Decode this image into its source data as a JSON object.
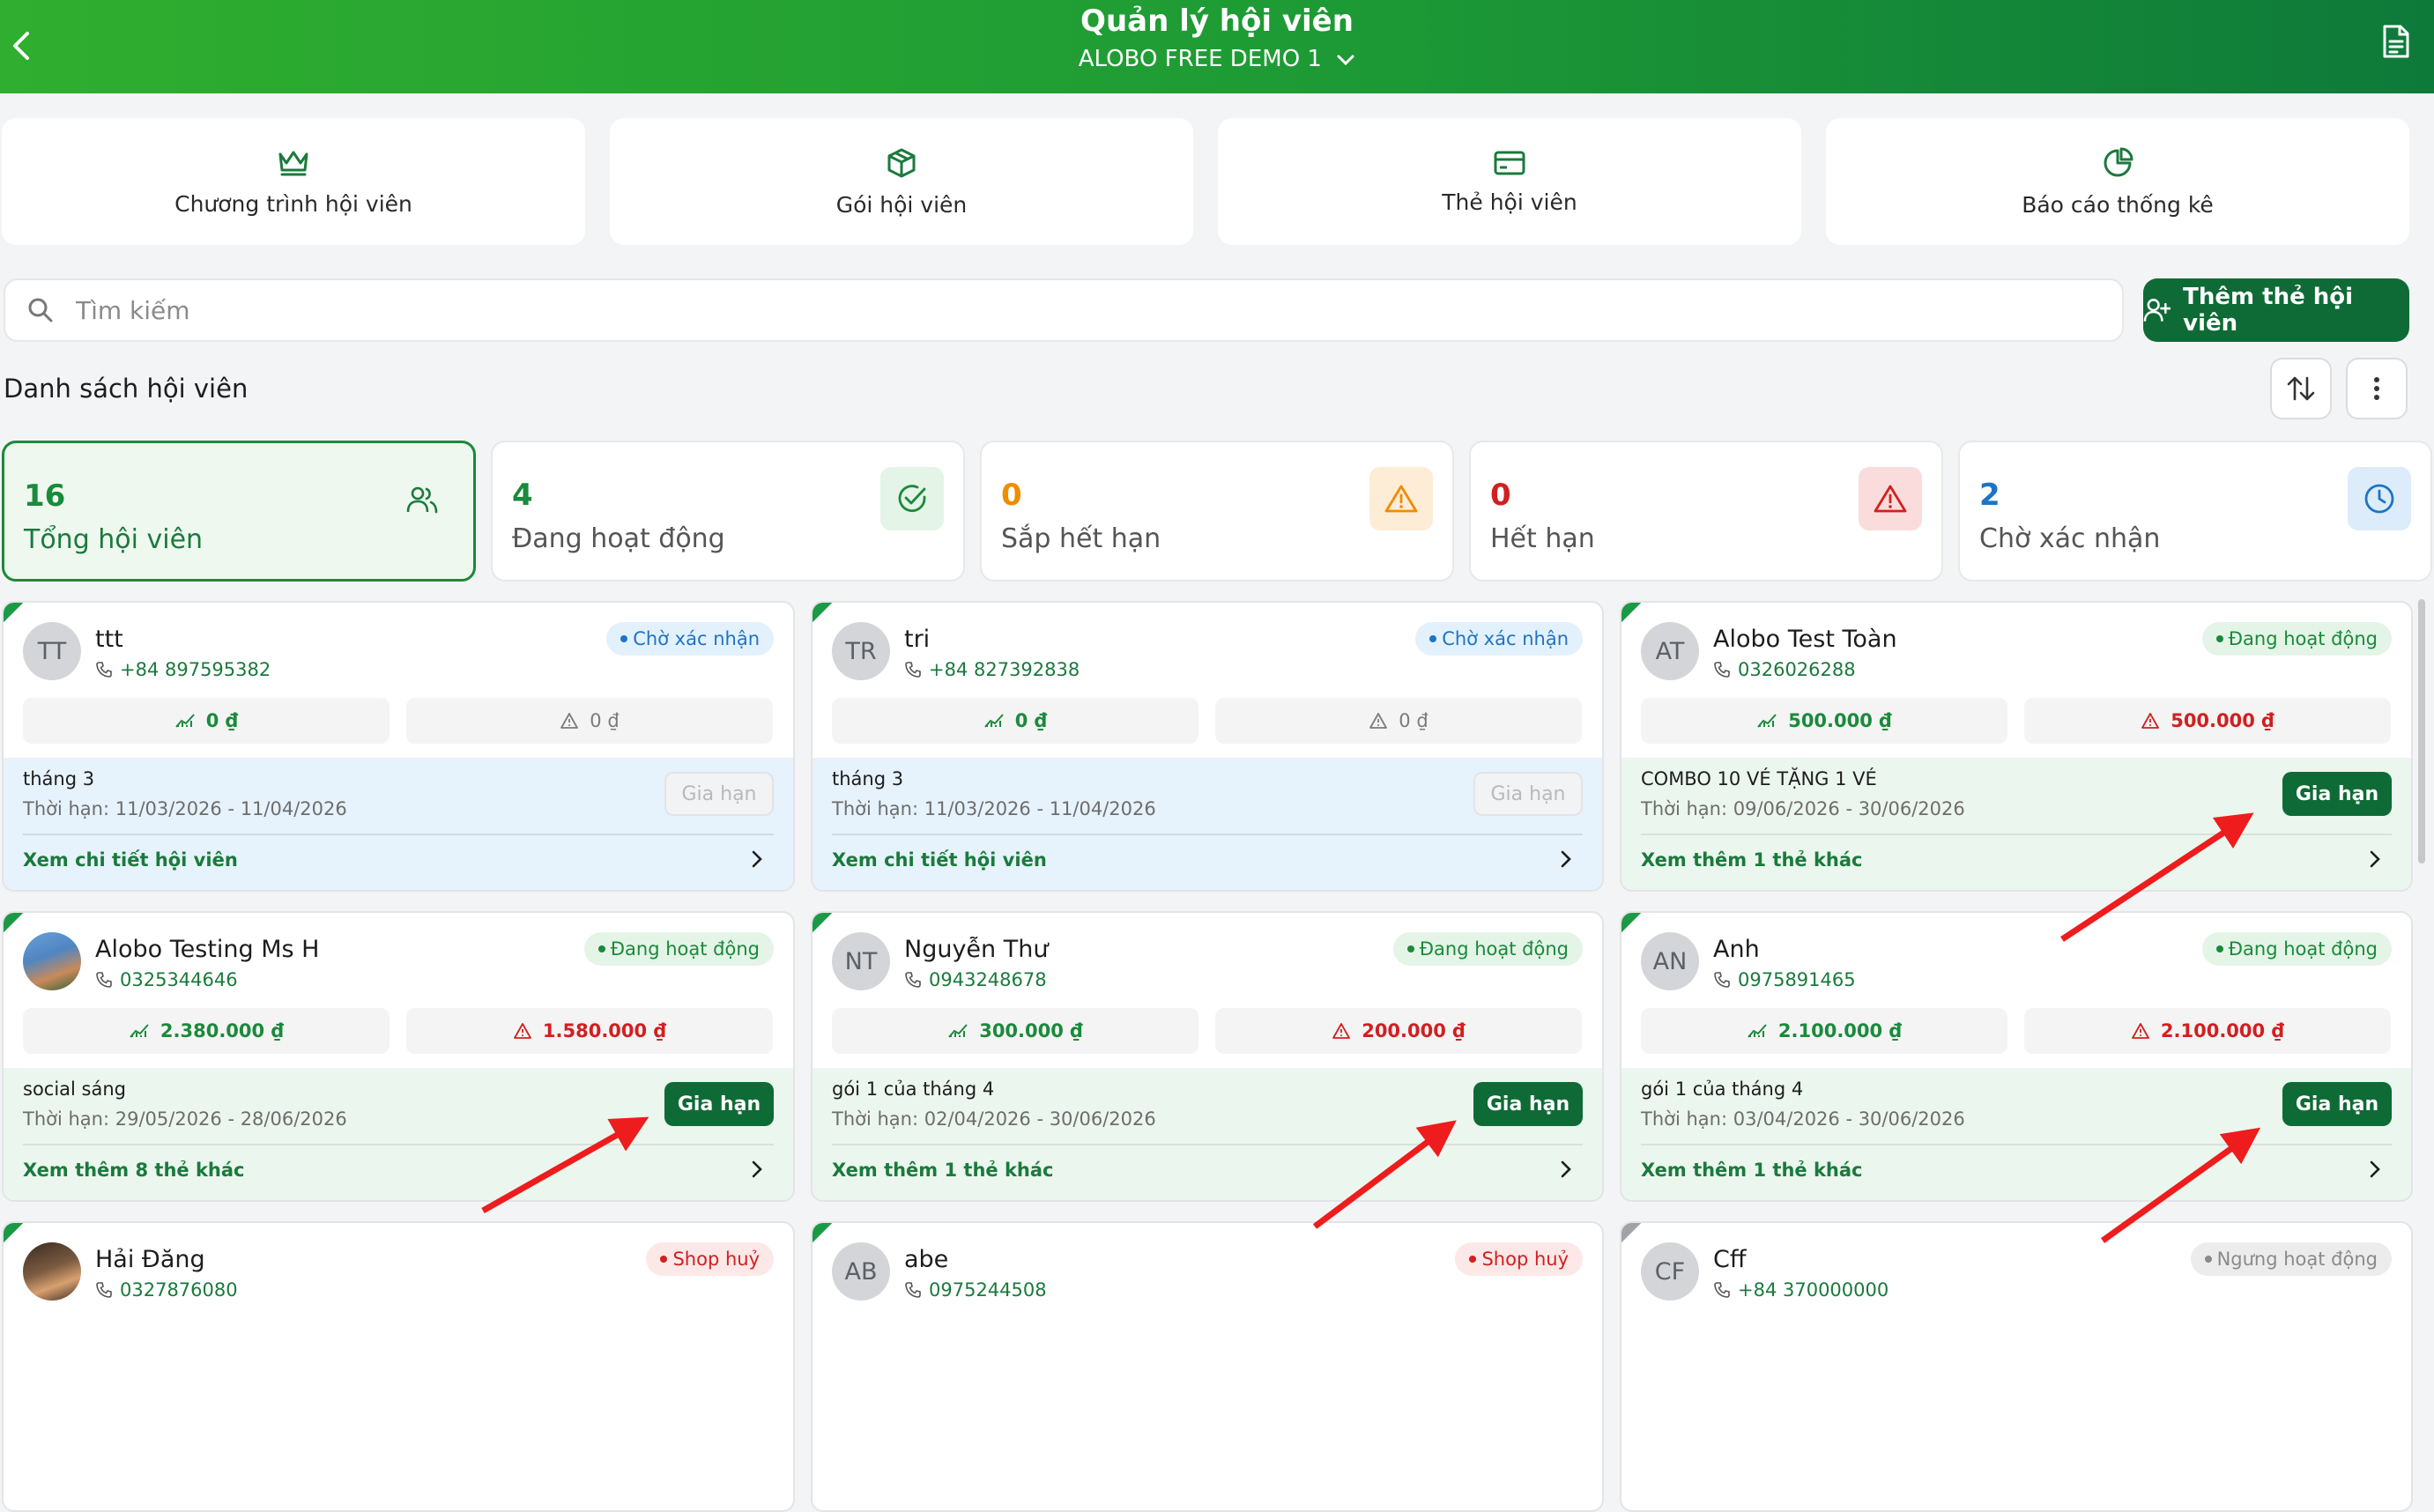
{
  "header": {
    "title": "Quản lý hội viên",
    "store": "ALOBO FREE DEMO 1"
  },
  "tiles": [
    {
      "label": "Chương trình hội viên",
      "icon": "crown-icon"
    },
    {
      "label": "Gói hội viên",
      "icon": "box-icon"
    },
    {
      "label": "Thẻ hội viên",
      "icon": "card-icon"
    },
    {
      "label": "Báo cáo thống kê",
      "icon": "pie-chart-icon"
    }
  ],
  "search": {
    "placeholder": "Tìm kiếm"
  },
  "add_button": "Thêm thẻ hội viên",
  "list_title": "Danh sách hội viên",
  "stats": [
    {
      "value": "16",
      "label": "Tổng hội viên",
      "color": "#1a8a3b"
    },
    {
      "value": "4",
      "label": "Đang hoạt động",
      "color": "#1a8a3b"
    },
    {
      "value": "0",
      "label": "Sắp hết hạn",
      "color": "#f08c00"
    },
    {
      "value": "0",
      "label": "Hết hạn",
      "color": "#d21f1f"
    },
    {
      "value": "2",
      "label": "Chờ xác nhận",
      "color": "#1d74c4"
    }
  ],
  "members": [
    {
      "initials": "TT",
      "name": "ttt",
      "phone": "+84 897595382",
      "status": "Chờ xác nhận",
      "paid": "0 ₫",
      "debt": "0 ₫",
      "package": "tháng 3",
      "term": "Thời hạn: 11/03/2026 - 11/04/2026",
      "renew": "Gia hạn",
      "link": "Xem chi tiết hội viên"
    },
    {
      "initials": "TR",
      "name": "tri",
      "phone": "+84 827392838",
      "status": "Chờ xác nhận",
      "paid": "0 ₫",
      "debt": "0 ₫",
      "package": "tháng 3",
      "term": "Thời hạn: 11/03/2026 - 11/04/2026",
      "renew": "Gia hạn",
      "link": "Xem chi tiết hội viên"
    },
    {
      "initials": "AT",
      "name": "Alobo Test Toàn",
      "phone": "0326026288",
      "status": "Đang hoạt động",
      "paid": "500.000 ₫",
      "debt": "500.000 ₫",
      "package": "COMBO 10 VÉ TẶNG 1 VÉ",
      "term": "Thời hạn: 09/06/2026 - 30/06/2026",
      "renew": "Gia hạn",
      "link": "Xem thêm 1 thẻ khác"
    },
    {
      "initials": "",
      "name": "Alobo Testing Ms H",
      "phone": "0325344646",
      "status": "Đang hoạt động",
      "paid": "2.380.000 ₫",
      "debt": "1.580.000 ₫",
      "package": "social sáng",
      "term": "Thời hạn: 29/05/2026 - 28/06/2026",
      "renew": "Gia hạn",
      "link": "Xem thêm 8 thẻ khác"
    },
    {
      "initials": "NT",
      "name": "Nguyễn Thư",
      "phone": "0943248678",
      "status": "Đang hoạt động",
      "paid": "300.000 ₫",
      "debt": "200.000 ₫",
      "package": "gói 1 của tháng 4",
      "term": "Thời hạn: 02/04/2026 - 30/06/2026",
      "renew": "Gia hạn",
      "link": "Xem thêm 1 thẻ khác"
    },
    {
      "initials": "AN",
      "name": "Anh",
      "phone": "0975891465",
      "status": "Đang hoạt động",
      "paid": "2.100.000 ₫",
      "debt": "2.100.000 ₫",
      "package": "gói 1 của tháng 4",
      "term": "Thời hạn: 03/04/2026 - 30/06/2026",
      "renew": "Gia hạn",
      "link": "Xem thêm 1 thẻ khác"
    },
    {
      "initials": "",
      "name": "Hải Đăng",
      "phone": "0327876080",
      "status": "Shop huỷ"
    },
    {
      "initials": "AB",
      "name": "abe",
      "phone": "0975244508",
      "status": "Shop huỷ"
    },
    {
      "initials": "CF",
      "name": "Cff",
      "phone": "+84 370000000",
      "status": "Ngưng hoạt động"
    }
  ],
  "colors": {
    "brand": "#0f6b36",
    "active": "#1a8a3b",
    "pending": "#1d74c4",
    "danger": "#d21f1f",
    "warning": "#f08c00"
  }
}
